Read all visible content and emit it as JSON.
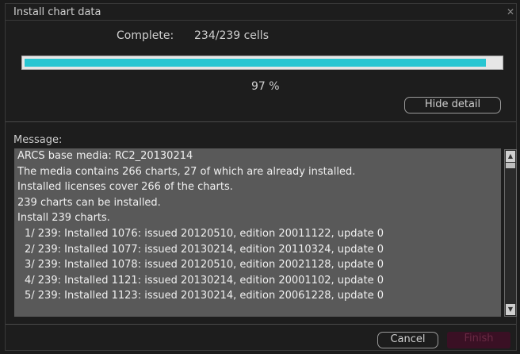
{
  "window": {
    "title": "Install chart data"
  },
  "status": {
    "complete_label": "Complete:",
    "complete_value": "234/239 cells",
    "progress_fraction": 0.97,
    "percent_text": "97 %"
  },
  "buttons": {
    "hide_detail": "Hide detail",
    "cancel": "Cancel",
    "finish": "Finish"
  },
  "message": {
    "label": "Message:",
    "lines": [
      "ARCS base media: RC2_20130214",
      "The media contains 266 charts, 27 of which are already installed.",
      "Installed licenses cover 266 of the charts.",
      "239 charts can be installed.",
      "Install 239 charts.",
      "1/ 239: Installed 1076: issued 20120510, edition 20011122, update 0",
      "2/ 239: Installed 1077: issued 20130214, edition 20110324, update 0",
      "3/ 239: Installed 1078: issued 20120510, edition 20021128, update 0",
      "4/ 239: Installed 1121: issued 20130214, edition 20001102, update 0",
      "5/ 239: Installed 1123: issued 20130214, edition 20061228, update 0"
    ]
  },
  "icons": {
    "close": "close-icon",
    "scroll_up": "scroll-up-arrow-icon",
    "scroll_down": "scroll-down-arrow-icon"
  },
  "colors": {
    "progress_fill": "#28c6d2",
    "message_background": "#595959",
    "finish_disabled": "#3a1024"
  }
}
